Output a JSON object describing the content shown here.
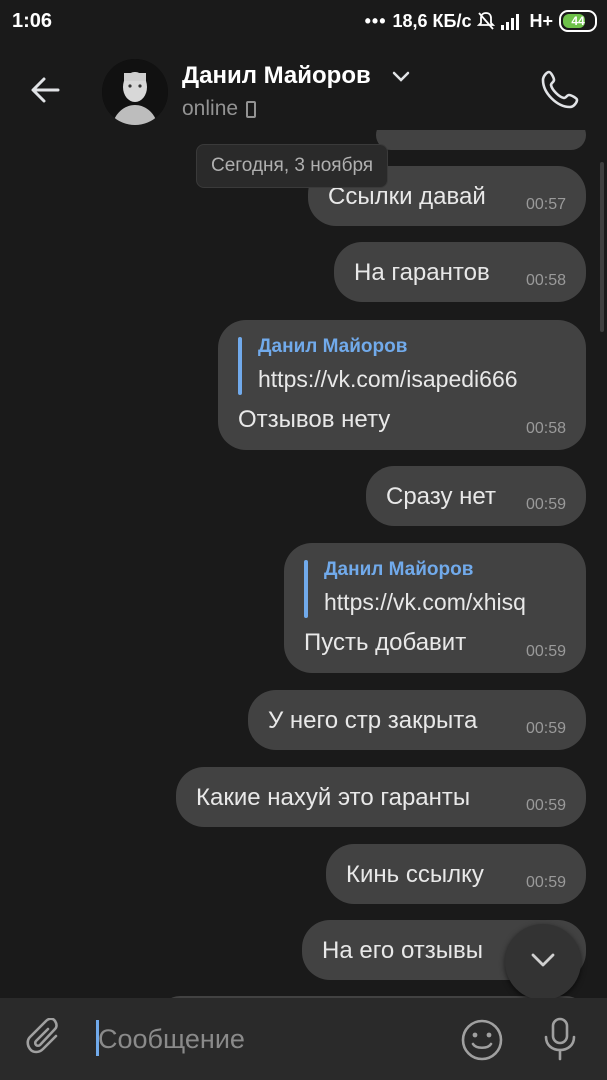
{
  "status_bar": {
    "time": "1:06",
    "speed": "18,6 КБ/с",
    "network": "H+",
    "battery": "44"
  },
  "header": {
    "name": "Данил Майоров",
    "status": "online"
  },
  "date_chip": "Сегодня, 3 ноября",
  "messages": [
    {
      "text": "Ссылки давай",
      "time": "00:57"
    },
    {
      "text": "На гарантов",
      "time": "00:58"
    },
    {
      "reply_name": "Данил Майоров",
      "reply_text": "https://vk.com/isapedi666",
      "text": "Отзывов нету",
      "time": "00:58"
    },
    {
      "text": "Сразу нет",
      "time": "00:59"
    },
    {
      "reply_name": "Данил Майоров",
      "reply_text": "https://vk.com/xhisq",
      "text": "Пусть добавит",
      "time": "00:59"
    },
    {
      "text": "У него стр закрыта",
      "time": "00:59"
    },
    {
      "text": "Какие нахуй это гаранты",
      "time": "00:59"
    },
    {
      "text": "Кинь ссылку",
      "time": "00:59"
    },
    {
      "text": "На его отзывы",
      "time": ""
    }
  ],
  "composer": {
    "placeholder": "Сообщение"
  },
  "icons": {
    "back": "arrow-left-icon",
    "call": "phone-icon",
    "attach": "paperclip-icon",
    "emoji": "smiley-icon",
    "mic": "microphone-icon",
    "scroll_down": "chevron-down-icon"
  },
  "colors": {
    "accent": "#71aaeb",
    "bubble": "#424242",
    "background": "#1a1a1a"
  }
}
